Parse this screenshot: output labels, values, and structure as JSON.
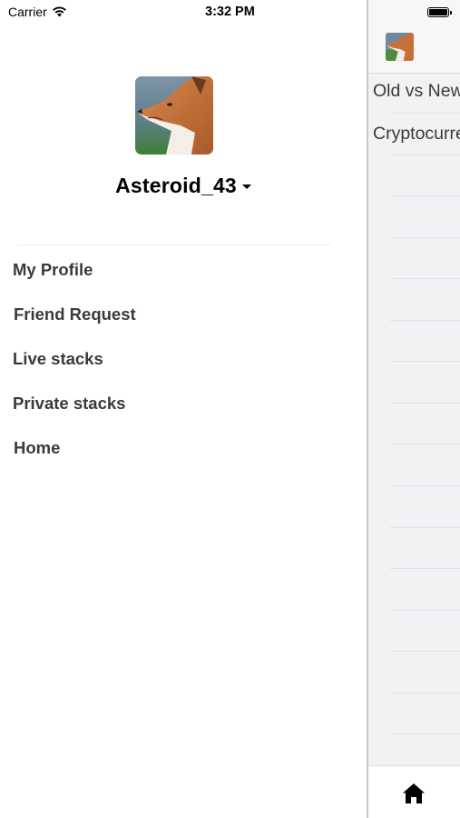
{
  "status_bar": {
    "carrier": "Carrier",
    "time": "3:32 PM"
  },
  "drawer": {
    "username": "Asteroid_43",
    "menu": [
      {
        "label": "My Profile"
      },
      {
        "label": "Friend Request"
      },
      {
        "label": "Live stacks"
      },
      {
        "label": "Private stacks"
      },
      {
        "label": "Home"
      }
    ]
  },
  "main": {
    "feed": [
      {
        "title": "Old vs New"
      },
      {
        "title": "Cryptocurrency"
      }
    ],
    "tab_bar": {
      "active_icon": "home-icon"
    }
  },
  "colors": {
    "menu_text": "#3a3a3c",
    "background": "#ffffff",
    "main_background": "#f2f2f4"
  }
}
